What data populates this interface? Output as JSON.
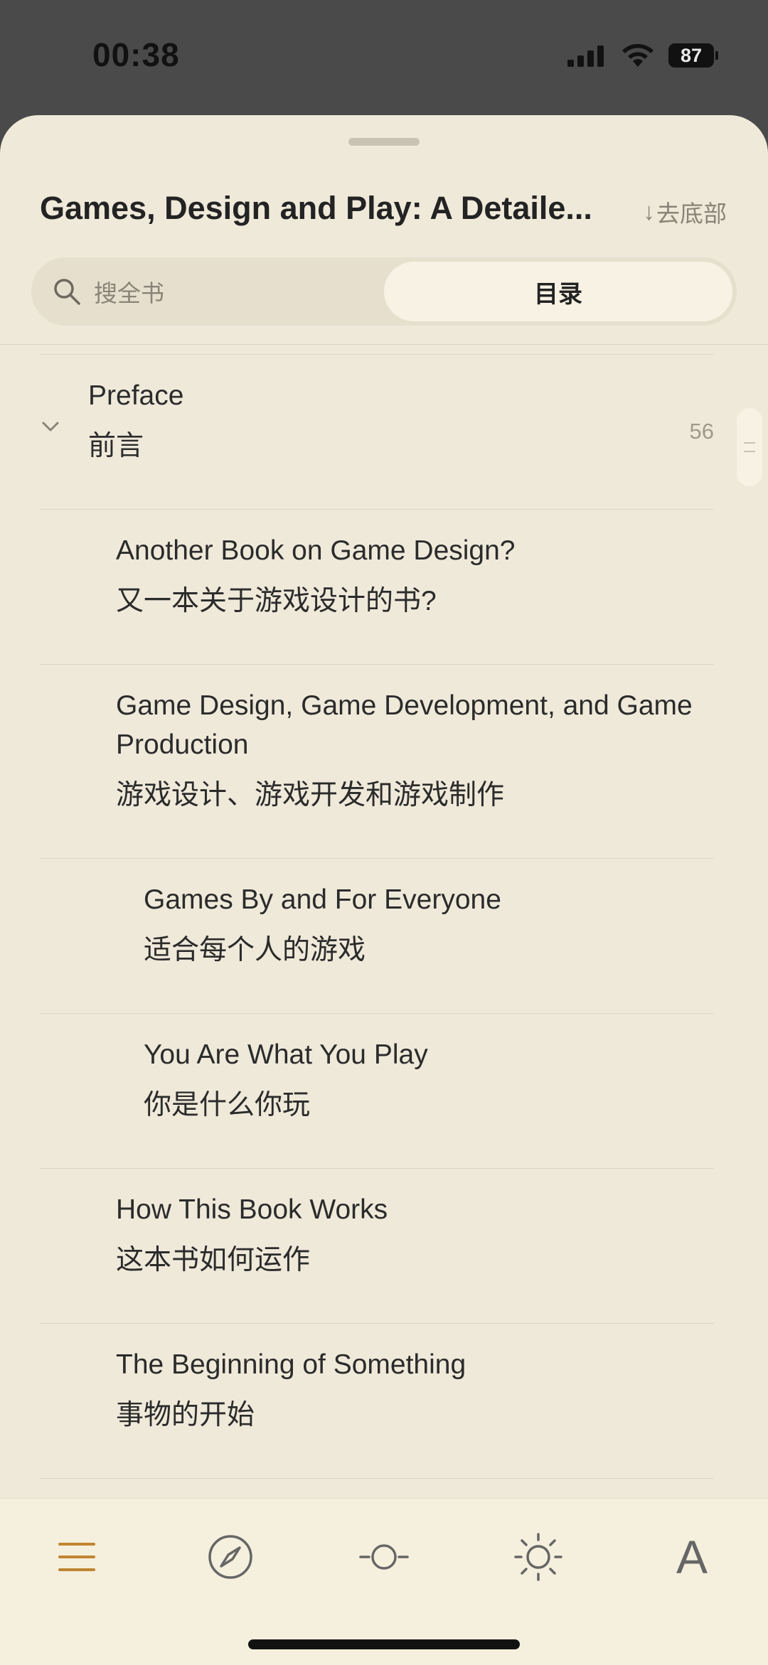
{
  "status_bar": {
    "time": "00:38",
    "battery": "87"
  },
  "sheet": {
    "book_title": "Games, Design and Play: A Detaile...",
    "to_bottom_arrow": "↓",
    "to_bottom_label": "去底部",
    "search_label": "搜全书",
    "toc_label": "目录"
  },
  "toc": {
    "items": [
      {
        "en": "Preface",
        "zh": "前言",
        "page": "56"
      },
      {
        "en": "Another Book on Game Design?",
        "zh": "又一本关于游戏设计的书?"
      },
      {
        "en": "Game Design, Game Development, and Game Production",
        "zh": "游戏设计、游戏开发和游戏制作"
      },
      {
        "en": "Games By and For Everyone",
        "zh": "适合每个人的游戏"
      },
      {
        "en": "You Are What You Play",
        "zh": "你是什么你玩"
      },
      {
        "en": "How This Book Works",
        "zh": "这本书如何运作"
      },
      {
        "en": "The Beginning of Something",
        "zh": "事物的开始"
      }
    ]
  },
  "toolbar": {
    "font_label": "A",
    "active_color": "#c08530",
    "icon_color": "#666666"
  }
}
